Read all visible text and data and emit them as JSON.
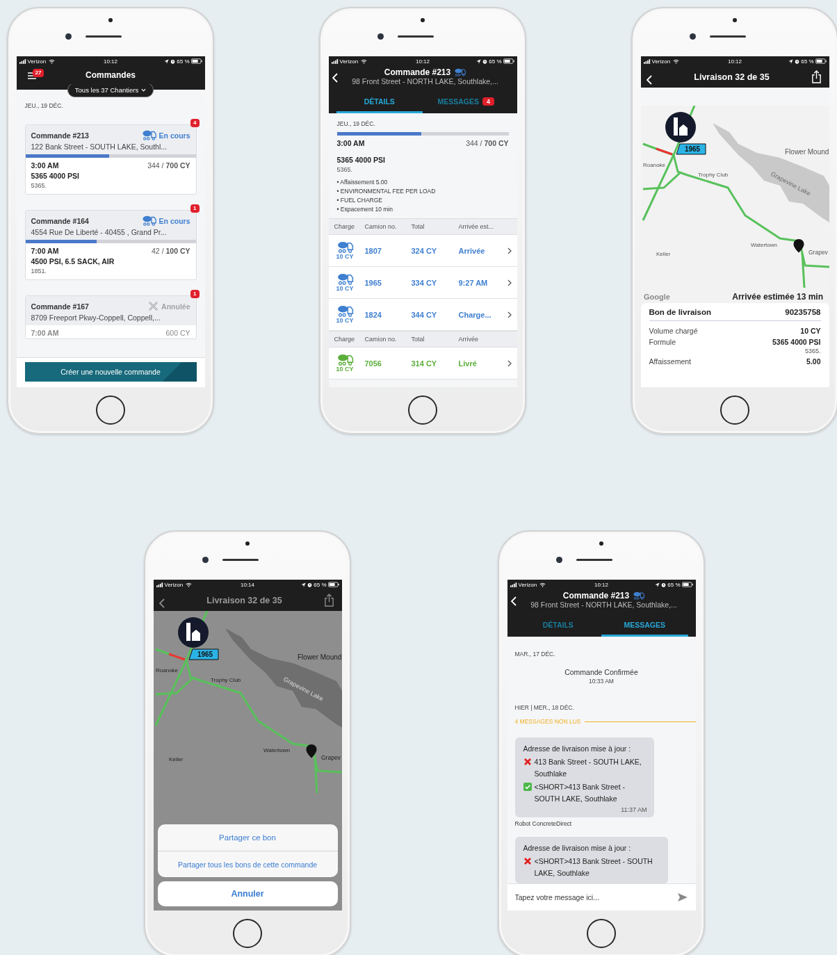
{
  "phones": [
    {
      "kind": "orders",
      "status": {
        "carrier": "Verizon",
        "time": "10:12",
        "battery": "65 %"
      },
      "title": "Commandes",
      "menu_badge": "27",
      "filter": "Tous les 37 Chantiers",
      "date": "JEU., 19 DÉC.",
      "orders": [
        {
          "title": "Commande #213",
          "kind": "in_progress",
          "status": "En cours",
          "badge": "4",
          "address": "122 Bank Street - SOUTH LAKE,  Southl...",
          "level": 0.49,
          "time": "3:00 AM",
          "quantity": "344 / **700 CY**",
          "product": "5365 4000 PSI",
          "code": "5365."
        },
        {
          "title": "Commande #164",
          "kind": "in_progress",
          "status": "En cours",
          "badge": "1",
          "address": "4554 Rue De Liberté - 40455 ,  Grand Pr...",
          "level": 0.42,
          "time": "7:00 AM",
          "quantity": "42 / **100 CY**",
          "product": "4500 PSI, 6.5 SACK, AIR",
          "code": "1851."
        },
        {
          "title": "Commande #167",
          "kind": "cancelled",
          "status": "Annulée",
          "badge": "1",
          "address": "8709  Freeport Pkwy-Coppell,  Coppell,...",
          "time": "7:00 AM",
          "quantity": "600 CY"
        }
      ],
      "create_button": "Créer une nouvelle commande"
    },
    {
      "kind": "order_details",
      "status": {
        "carrier": "Verizon",
        "time": "10:12",
        "battery": "65 %"
      },
      "title": "Commande #213",
      "address": "98 Front Street - NORTH LAKE,  Southlake,...",
      "tabs": [
        {
          "label": "DÉTAILS",
          "selected": true
        },
        {
          "label": "MESSAGES",
          "selected": false,
          "badge": "4"
        }
      ],
      "date": "JEU., 19 DÉC.",
      "level": 0.49,
      "time": "3:00 AM",
      "quantity": "344 / **700 CY**",
      "product": "5365 4000 PSI",
      "code": "5365.",
      "notes": [
        "• Affaissement 5.00",
        "• ENVIRONMENTAL FEE PER LOAD",
        "• FUEL CHARGE",
        "• Espacement 10 min"
      ],
      "tables": [
        {
          "columns": [
            "Charge",
            "Camion no.",
            "Total",
            "Arrivée est..."
          ],
          "rows": [
            {
              "kind": "active",
              "load": "10 CY",
              "truck": "1807",
              "total": "324 CY",
              "arrival": "Arrivée"
            },
            {
              "kind": "active",
              "load": "10 CY",
              "truck": "1965",
              "total": "334 CY",
              "arrival": "9:27 AM"
            },
            {
              "kind": "active",
              "load": "10 CY",
              "truck": "1824",
              "total": "344 CY",
              "arrival": "Charge..."
            }
          ]
        },
        {
          "columns": [
            "Charge",
            "Camion no.",
            "Total",
            "Arrivée"
          ],
          "rows": [
            {
              "kind": "delivered",
              "load": "10 CY",
              "truck": "7056",
              "total": "314 CY",
              "arrival": "Livré"
            }
          ]
        }
      ]
    },
    {
      "kind": "delivery_map",
      "status": {
        "carrier": "Verizon",
        "time": "10:12",
        "battery": "65 %"
      },
      "title": "Livraison 32 de 35",
      "map": {
        "labels": [
          "Flower Mound",
          "Grapevine Lake",
          "Roanoke",
          "Trophy Club",
          "Keller",
          "Watertown",
          "Grapev"
        ],
        "truck_tag": "1965",
        "attribution": "Google",
        "eta": "Arrivée estimée 13 min"
      },
      "ticket": {
        "title": "Bon de livraison",
        "number": "90235758",
        "rows": [
          {
            "label": "Volume chargé",
            "value": "10 CY"
          },
          {
            "label": "Formule",
            "value": "5365 4000 PSI",
            "sub": "5365."
          },
          {
            "label": "Affaissement",
            "value": "5.00"
          }
        ]
      }
    },
    {
      "kind": "delivery_share",
      "status": {
        "carrier": "Verizon",
        "time": "10:14",
        "battery": "65 %"
      },
      "title": "Livraison 32 de 35",
      "map": {
        "labels": [
          "Flower Mound",
          "Grapevine Lake",
          "Roanoke",
          "Trophy Club",
          "Keller",
          "Watertown",
          "Grapev"
        ],
        "truck_tag": "1965"
      },
      "actions": [
        "Partager ce bon",
        "Partager tous les bons de cette commande"
      ],
      "cancel": "Annuler"
    },
    {
      "kind": "order_messages",
      "status": {
        "carrier": "Verizon",
        "time": "10:12",
        "battery": "65 %"
      },
      "title": "Commande #213",
      "address": "98 Front Street - NORTH LAKE,  Southlake,...",
      "tabs": [
        {
          "label": "DÉTAILS",
          "selected": false
        },
        {
          "label": "MESSAGES",
          "selected": true
        }
      ],
      "day1": "MAR., 17 DÉC.",
      "event": {
        "text": "Commande Confirmée",
        "time": "10:33 AM"
      },
      "day2": "HIER | MER., 18 DÉC.",
      "unread": "4 MESSAGES NON LUS",
      "messages": [
        {
          "lines": [
            {
              "kind": "text",
              "text": "Adresse de livraison mise à jour :"
            },
            {
              "kind": "removed",
              "text": "413 Bank Street - SOUTH LAKE,  Southlake"
            },
            {
              "kind": "added",
              "text": "<SHORT>413 Bank Street - SOUTH LAKE,  Southlake"
            }
          ],
          "time": "11:37 AM",
          "sender": "Robot ConcreteDirect"
        },
        {
          "lines": [
            {
              "kind": "text",
              "text": "Adresse de livraison mise à jour :"
            },
            {
              "kind": "removed",
              "text": "<SHORT>413 Bank Street - SOUTH LAKE,  Southlake"
            }
          ]
        }
      ],
      "placeholder": "Tapez votre message ici..."
    }
  ]
}
